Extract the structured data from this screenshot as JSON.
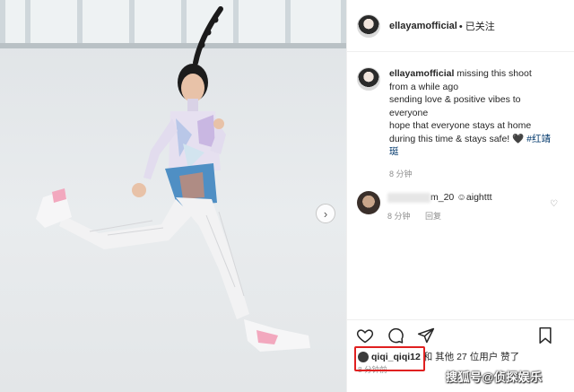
{
  "header": {
    "username": "ellayamofficial",
    "follow_status": "• 已关注"
  },
  "caption": {
    "username": "ellayamofficial",
    "lines": [
      "missing this shoot",
      "from a while ago",
      "sending love & positive vibes to",
      "everyone",
      "hope that everyone stays at home",
      "during this time & stays safe! 🖤"
    ],
    "hashtag_part1": "#红靖",
    "hashtag_part2": "珽",
    "timestamp": "8 分钟"
  },
  "comment": {
    "username_suffix": "m_20",
    "text": "aighttt",
    "timestamp": "8 分钟",
    "reply_label": "回复"
  },
  "likes": {
    "liker": "qiqi_qiqi12",
    "rest": " 和 其他 27 位用户 赞了"
  },
  "post_timestamp": "8 分钟前",
  "watermark": "搜狐号@侦探娱乐",
  "icons": {
    "like": "heart-icon",
    "comment": "comment-icon",
    "share": "send-icon",
    "save": "bookmark-icon",
    "next": "chevron-right-icon"
  },
  "colors": {
    "highlight": "#e02020",
    "hashtag": "#00376b",
    "muted": "#8e8e8e"
  }
}
